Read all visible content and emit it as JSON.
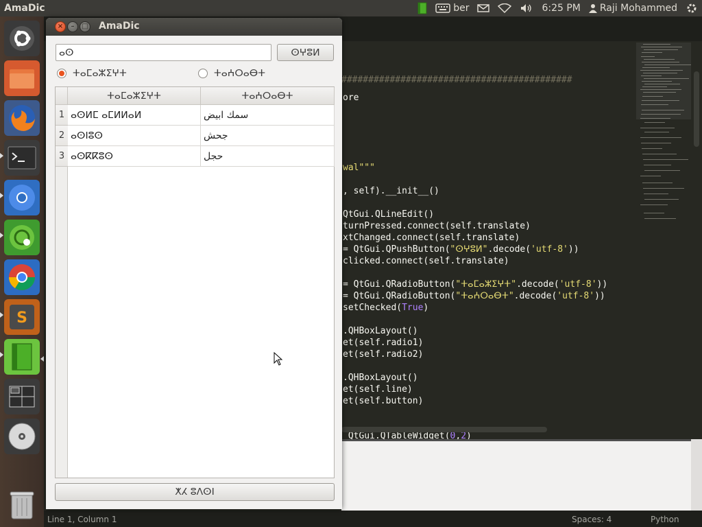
{
  "top_panel": {
    "app_title": "AmaDic",
    "keyboard_layout": "ber",
    "time": "6:25 PM",
    "user": "Raji Mohammed"
  },
  "launcher": {
    "items": [
      "ubuntu-home",
      "files",
      "firefox",
      "terminal",
      "chromium",
      "remote-desktop",
      "chrome",
      "sublime-text",
      "amadic-book",
      "workspace-switcher",
      "dvd-drive",
      "trash"
    ]
  },
  "amadic": {
    "title": "AmaDic",
    "search_value": "ⴰⵙ",
    "translate_label": "ⵙⵖⵓⵍ",
    "radio1_label": "ⵜⴰⵎⴰⵣⵉⵖⵜ",
    "radio2_label": "ⵜⴰⵄⵔⴰⴱⵜ",
    "radio1_checked": true,
    "table": {
      "headers": [
        "ⵜⴰⵎⴰⵣⵉⵖⵜ",
        "ⵜⴰⵄⵔⴰⴱⵜ"
      ],
      "rows": [
        {
          "num": "1",
          "ber": "ⴰⵙⵍⵎ ⴰⵎⵍⵍⴰⵍ",
          "ar": "سمك ابيض"
        },
        {
          "num": "2",
          "ber": "ⴰⵙⵏⵓⵙ",
          "ar": "جحش"
        },
        {
          "num": "3",
          "ber": "ⴰⵙⴽⴽⵓⵙ",
          "ar": "حجل"
        }
      ]
    },
    "bottom_button_label": "ⵅⵃ ⵓⴷⵙⵏ"
  },
  "editor": {
    "code_lines": [
      {
        "text": "###########################################",
        "cls": "cm"
      },
      {
        "text": "ore",
        "cls": ""
      },
      {
        "text": "wal\"\"\"",
        "cls": "str"
      },
      {
        "text": ", self).__init__()",
        "cls": ""
      },
      {
        "text": "QtGui.QLineEdit()",
        "cls": ""
      },
      {
        "text": "turnPressed.connect(self.translate)",
        "cls": ""
      },
      {
        "text": "xtChanged.connect(self.translate)",
        "cls": ""
      },
      {
        "text": "= QtGui.QPushButton(\"ⵙⵖⵓⵍ\".decode('utf-8'))",
        "cls": ""
      },
      {
        "text": "clicked.connect(self.translate)",
        "cls": ""
      },
      {
        "text": "= QtGui.QRadioButton(\"ⵜⴰⵎⴰⵣⵉⵖⵜ\".decode('utf-8'))",
        "cls": ""
      },
      {
        "text": "= QtGui.QRadioButton(\"ⵜⴰⵄⵔⴰⴱⵜ\".decode('utf-8'))",
        "cls": ""
      },
      {
        "text": "setChecked(True)",
        "cls": ""
      },
      {
        "text": ".QHBoxLayout()",
        "cls": ""
      },
      {
        "text": "et(self.radio1)",
        "cls": ""
      },
      {
        "text": "et(self.radio2)",
        "cls": ""
      },
      {
        "text": ".QHBoxLayout()",
        "cls": ""
      },
      {
        "text": "et(self.line)",
        "cls": ""
      },
      {
        "text": "et(self.button)",
        "cls": ""
      },
      {
        "text": " QtGui.QTableWidget(0,2)",
        "cls": ""
      }
    ],
    "status_position": "Line 1, Column 1",
    "status_spaces": "Spaces: 4",
    "status_language": "Python"
  }
}
